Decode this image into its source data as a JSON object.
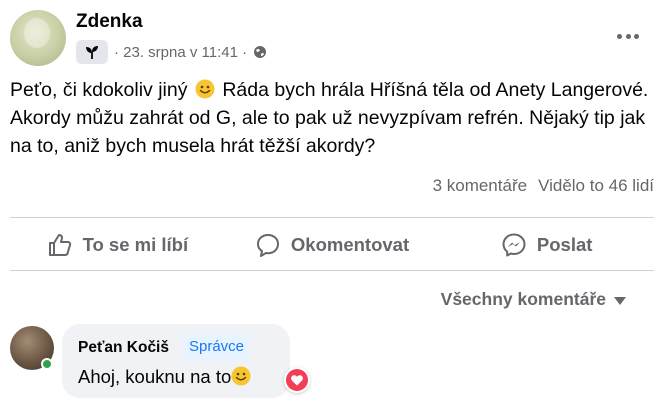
{
  "post": {
    "author": "Zdenka",
    "timestamp": "· 23. srpna v 11:41 ·",
    "audience_icon": "globe-icon",
    "group_icon": "sprout-icon",
    "text_part1": "Peťo,  či kdokoliv jiný",
    "text_part2": " Ráda bych hrála Hříšná těla od Anety Langerové. Akordy můžu zahrát od G,  ale to pak už nevyzpívam refrén. Nějaký tip jak na to, aniž bych musela hrát těžší akordy?",
    "comments_count": "3 komentáře",
    "views_count": "Vidělo to 46 lidí"
  },
  "actions": {
    "like_label": "To se mi líbí",
    "comment_label": "Okomentovat",
    "share_label": "Poslat"
  },
  "sort": {
    "label": "Všechny komentáře"
  },
  "comment": {
    "author": "Peťan Kočiš",
    "badge": "Správce",
    "text": "Ahoj, kouknu na to",
    "reaction": "love-icon"
  },
  "colors": {
    "text_secondary": "#65676b",
    "bubble_bg": "#f0f2f5",
    "badge_text": "#1877f2",
    "badge_bg": "#e7f3ff",
    "online": "#31a24c",
    "love": "#f33e58"
  }
}
